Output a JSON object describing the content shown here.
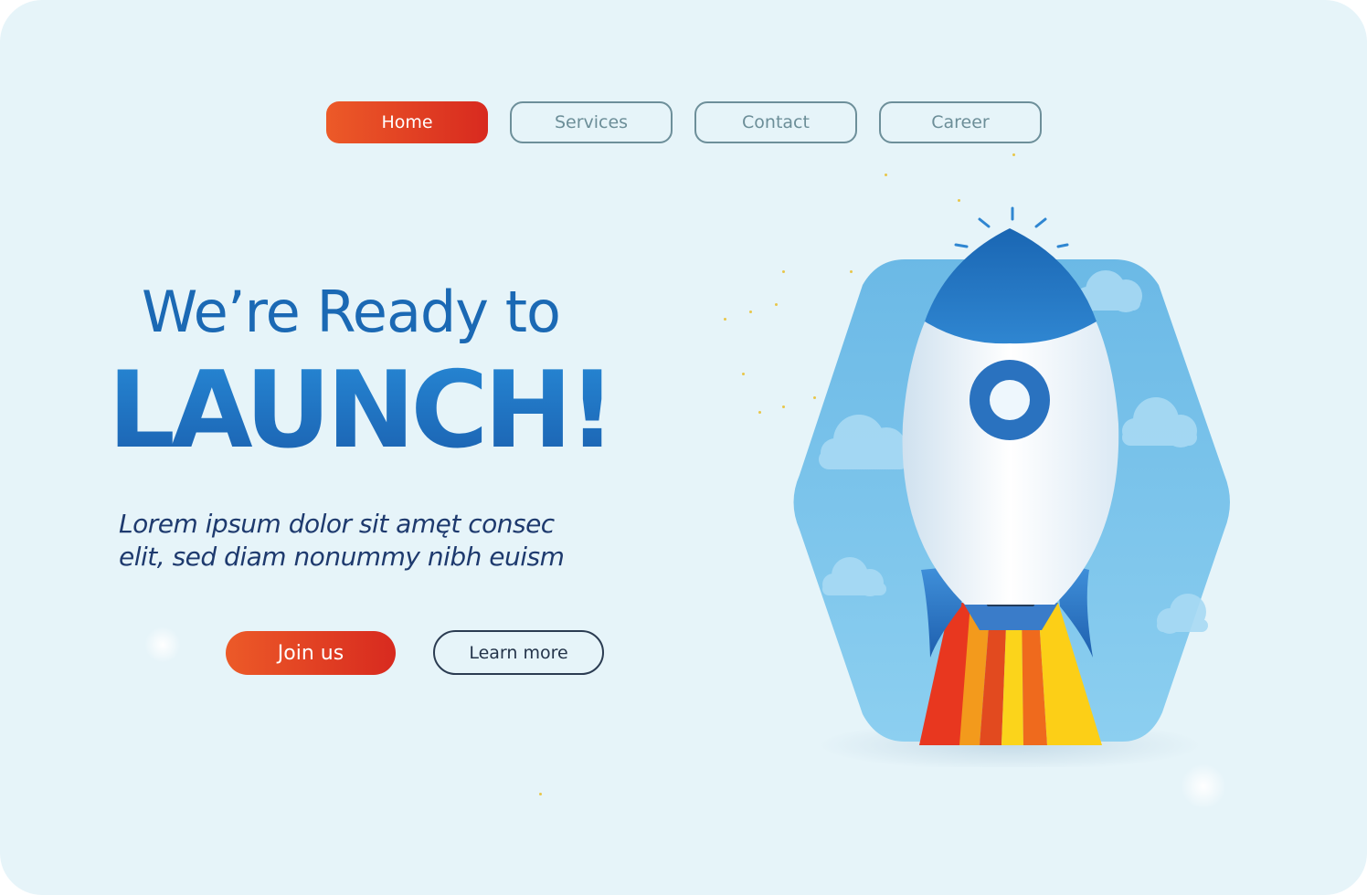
{
  "nav": {
    "items": [
      {
        "label": "Home",
        "active": true
      },
      {
        "label": "Services",
        "active": false
      },
      {
        "label": "Contact",
        "active": false
      },
      {
        "label": "Career",
        "active": false
      }
    ]
  },
  "hero": {
    "headline_line1": "We’re Ready to",
    "headline_line2": "LAUNCH!",
    "subtext_line1": "Lorem ipsum dolor sit amęt  consec",
    "subtext_line2": "elit, sed diam nonummy nibh euism"
  },
  "cta": {
    "primary_label": "Join us",
    "secondary_label": "Learn more"
  },
  "colors": {
    "accent_orange": "#ec5a28",
    "accent_red": "#d82a1f",
    "brand_blue": "#1b69b4",
    "background": "#e6f4f9",
    "hexagon_blue": "#7cc3ea"
  },
  "icons": {
    "illustration": "rocket-illustration"
  }
}
